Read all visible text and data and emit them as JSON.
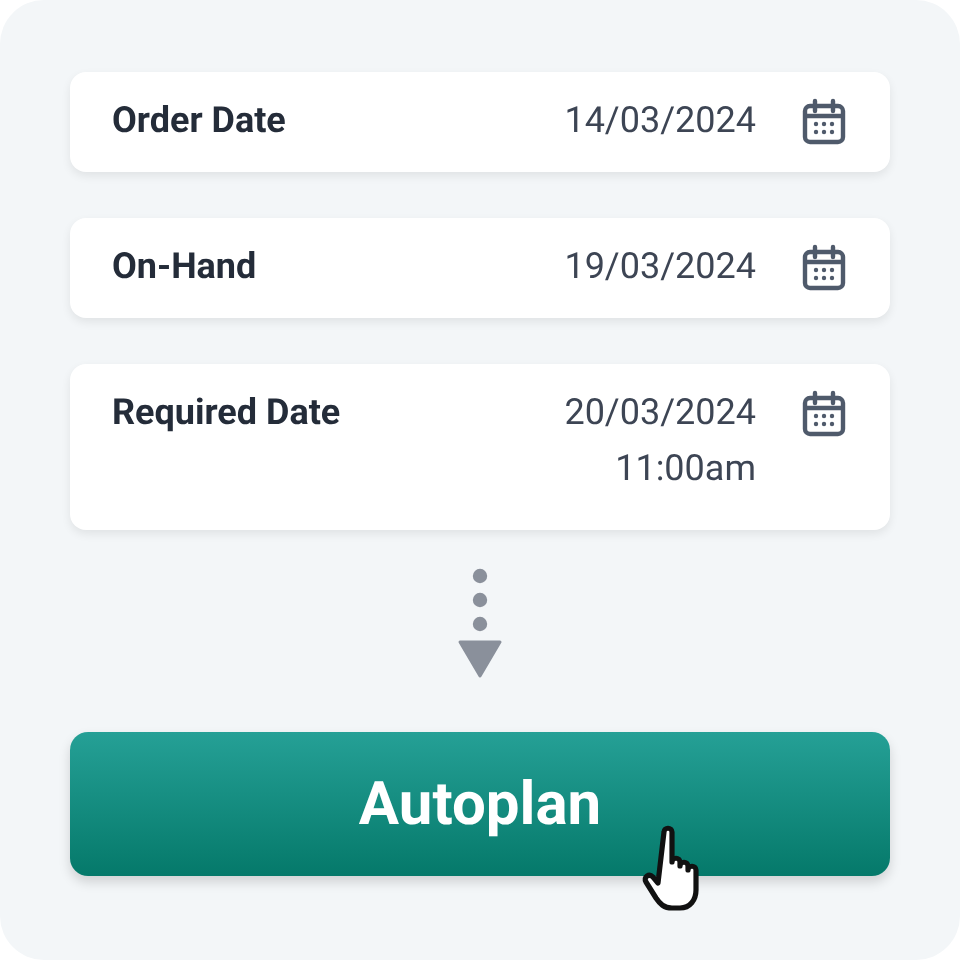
{
  "fields": [
    {
      "label": "Order Date",
      "value": [
        "14/03/2024"
      ]
    },
    {
      "label": "On-Hand",
      "value": [
        "19/03/2024"
      ]
    },
    {
      "label": "Required Date",
      "value": [
        "20/03/2024",
        "11:00am"
      ]
    }
  ],
  "button": {
    "label": "Autoplan"
  }
}
